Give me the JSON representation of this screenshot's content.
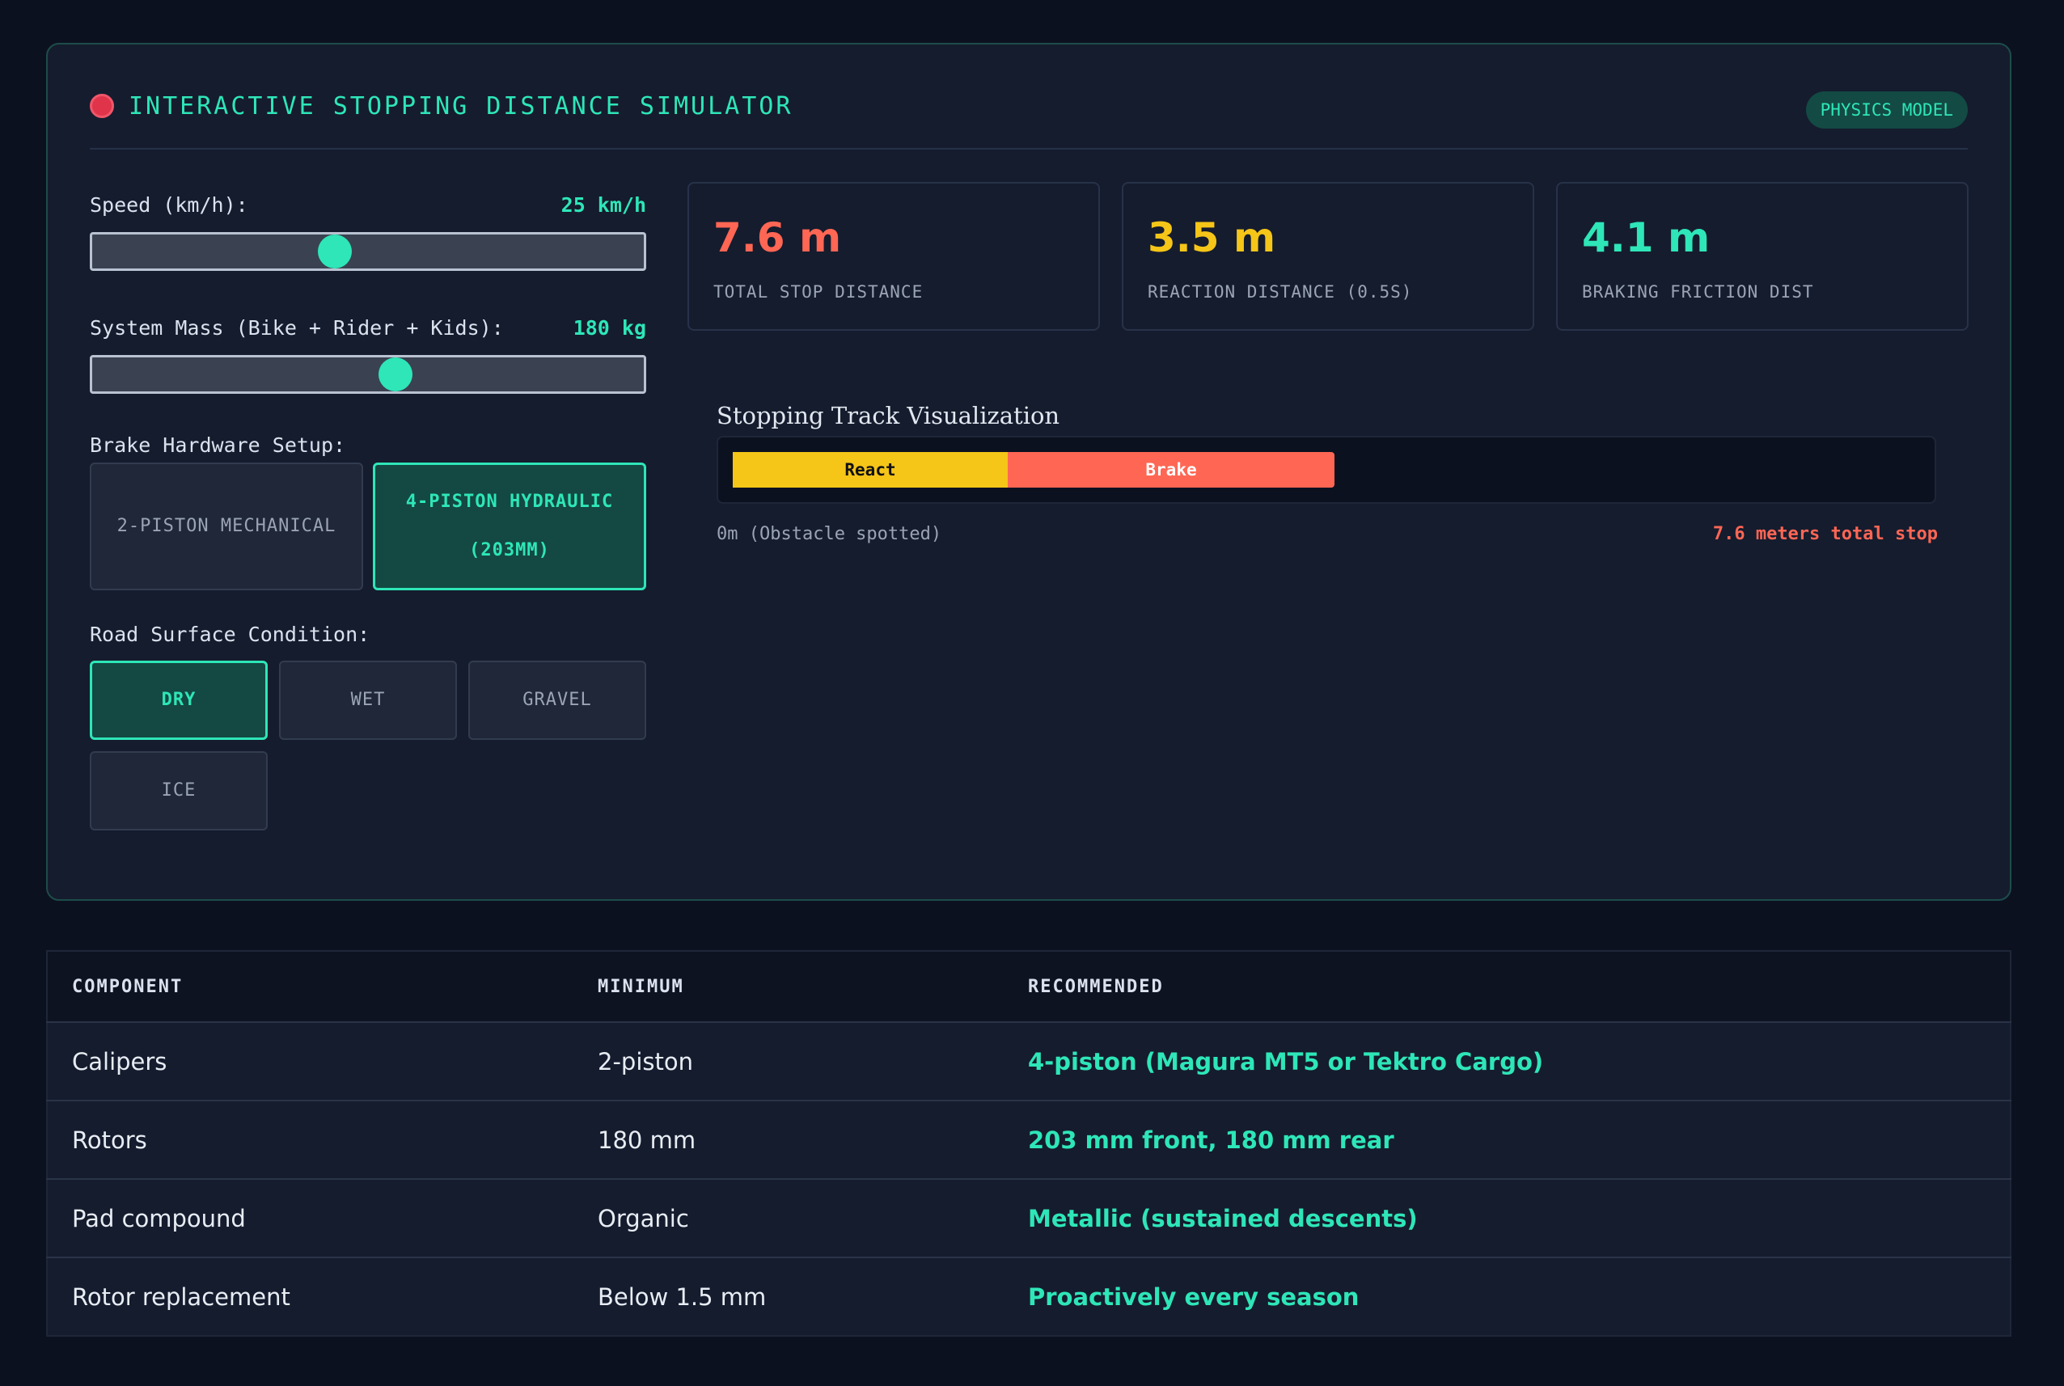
{
  "header": {
    "title": "INTERACTIVE STOPPING DISTANCE SIMULATOR",
    "badge": "PHYSICS MODEL",
    "status_color": "#e0344a"
  },
  "controls": {
    "speed": {
      "label": "Speed (km/h):",
      "value_text": "25 km/h",
      "value": 25,
      "fraction": 0.44
    },
    "mass": {
      "label": "System Mass (Bike + Rider + Kids):",
      "value_text": "180 kg",
      "value": 180,
      "fraction": 0.55
    },
    "brake_setup": {
      "label": "Brake Hardware Setup:",
      "options": [
        "2-PISTON MECHANICAL",
        "4-PISTON HYDRAULIC (203MM)"
      ],
      "selected": "4-PISTON HYDRAULIC (203MM)"
    },
    "surface": {
      "label": "Road Surface Condition:",
      "options": [
        "DRY",
        "WET",
        "GRAVEL",
        "ICE"
      ],
      "selected": "DRY"
    }
  },
  "stats": [
    {
      "value": "7.6 m",
      "label": "TOTAL STOP DISTANCE",
      "color": "#ff6654"
    },
    {
      "value": "3.5 m",
      "label": "REACTION DISTANCE (0.5S)",
      "color": "#f5c518"
    },
    {
      "value": "4.1 m",
      "label": "BRAKING FRICTION DIST",
      "color": "#2ee6b8"
    }
  ],
  "track": {
    "title": "Stopping Track Visualization",
    "react_label": "React",
    "brake_label": "Brake",
    "start_label": "0m (Obstacle spotted)",
    "end_label": "7.6 meters total stop"
  },
  "table": {
    "headers": [
      "COMPONENT",
      "MINIMUM",
      "RECOMMENDED"
    ],
    "rows": [
      [
        "Calipers",
        "2-piston",
        "4-piston (Magura MT5 or Tektro Cargo)"
      ],
      [
        "Rotors",
        "180 mm",
        "203 mm front, 180 mm rear"
      ],
      [
        "Pad compound",
        "Organic",
        "Metallic (sustained descents)"
      ],
      [
        "Rotor replacement",
        "Below 1.5 mm",
        "Proactively every season"
      ]
    ]
  }
}
